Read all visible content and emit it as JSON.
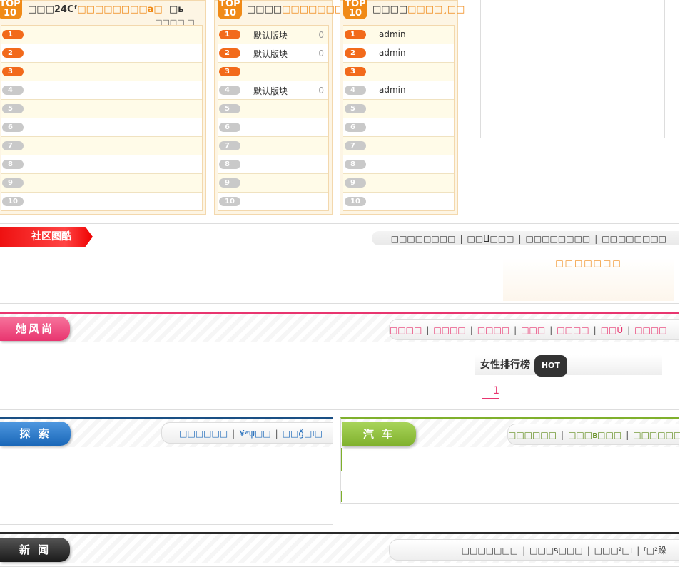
{
  "top_panels": [
    {
      "badge_top": "TOP",
      "badge_num": "10",
      "title_black": "□□□24Cᶠ",
      "title_orange": "□□□□□□□□a□",
      "sub_right": "□ь",
      "sub_below": "□□□□ □",
      "rows": [
        {
          "num": "1",
          "text": "",
          "count": ""
        },
        {
          "num": "2",
          "text": "",
          "count": ""
        },
        {
          "num": "3",
          "text": "",
          "count": ""
        },
        {
          "num": "4",
          "text": "",
          "count": ""
        },
        {
          "num": "5",
          "text": "",
          "count": ""
        },
        {
          "num": "6",
          "text": "",
          "count": ""
        },
        {
          "num": "7",
          "text": "",
          "count": ""
        },
        {
          "num": "8",
          "text": "",
          "count": ""
        },
        {
          "num": "9",
          "text": "",
          "count": ""
        },
        {
          "num": "10",
          "text": "",
          "count": ""
        }
      ]
    },
    {
      "badge_top": "TOP",
      "badge_num": "10",
      "title_black": "□□□□",
      "title_orange": "□□□□□□□□□",
      "rows": [
        {
          "num": "1",
          "text": "默认版块",
          "count": "0"
        },
        {
          "num": "2",
          "text": "默认版块",
          "count": "0"
        },
        {
          "num": "3",
          "text": "",
          "count": ""
        },
        {
          "num": "4",
          "text": "默认版块",
          "count": "0"
        },
        {
          "num": "5",
          "text": "",
          "count": ""
        },
        {
          "num": "6",
          "text": "",
          "count": ""
        },
        {
          "num": "7",
          "text": "",
          "count": ""
        },
        {
          "num": "8",
          "text": "",
          "count": ""
        },
        {
          "num": "9",
          "text": "",
          "count": ""
        },
        {
          "num": "10",
          "text": "",
          "count": ""
        }
      ]
    },
    {
      "badge_top": "TOP",
      "badge_num": "10",
      "title_black": "□□□□",
      "title_orange": "□□□□¸□□",
      "rows": [
        {
          "num": "1",
          "text": "admin",
          "count": ""
        },
        {
          "num": "2",
          "text": "admin",
          "count": ""
        },
        {
          "num": "3",
          "text": "",
          "count": ""
        },
        {
          "num": "4",
          "text": "admin",
          "count": ""
        },
        {
          "num": "5",
          "text": "",
          "count": ""
        },
        {
          "num": "6",
          "text": "",
          "count": ""
        },
        {
          "num": "7",
          "text": "",
          "count": ""
        },
        {
          "num": "8",
          "text": "",
          "count": ""
        },
        {
          "num": "9",
          "text": "",
          "count": ""
        },
        {
          "num": "10",
          "text": "",
          "count": ""
        }
      ]
    }
  ],
  "community": {
    "banner": "社区图酷",
    "links": [
      "□□□□□□□□",
      "□□Ц□□□",
      "□□□□□□□□",
      "□□□□□□□□"
    ],
    "center_text": "□□□□□□□"
  },
  "fashion": {
    "tab": "她风尚",
    "links": [
      "□□□□",
      "□□□□",
      "□□□□",
      "□□□",
      "□□□□",
      "□□Û",
      "□□□□"
    ],
    "ranking_title": "女性排行榜",
    "hot_label": "HOT",
    "ranking_item": "1"
  },
  "explore": {
    "tab": "探 索",
    "links": [
      "ˈ□□□□□□",
      "¥ʷψ□□",
      "□□ğ□ı□"
    ]
  },
  "car": {
    "tab": "汽 车",
    "links": [
      "□□□□□□",
      "□□□в□□□",
      "□□□□□□□թբ"
    ]
  },
  "news": {
    "tab": "新 闻",
    "links": [
      "□□□□□□□",
      "□□□٩□□□",
      "□□□²□ı",
      "ᶠ□²跺"
    ]
  },
  "colors": {
    "orange": "#f08a17",
    "fashion_pink": "#e8356f",
    "explore_blue": "#1a67b8",
    "car_green": "#7fb02c",
    "news_black": "#2a2a2a",
    "community_red": "#e11"
  }
}
